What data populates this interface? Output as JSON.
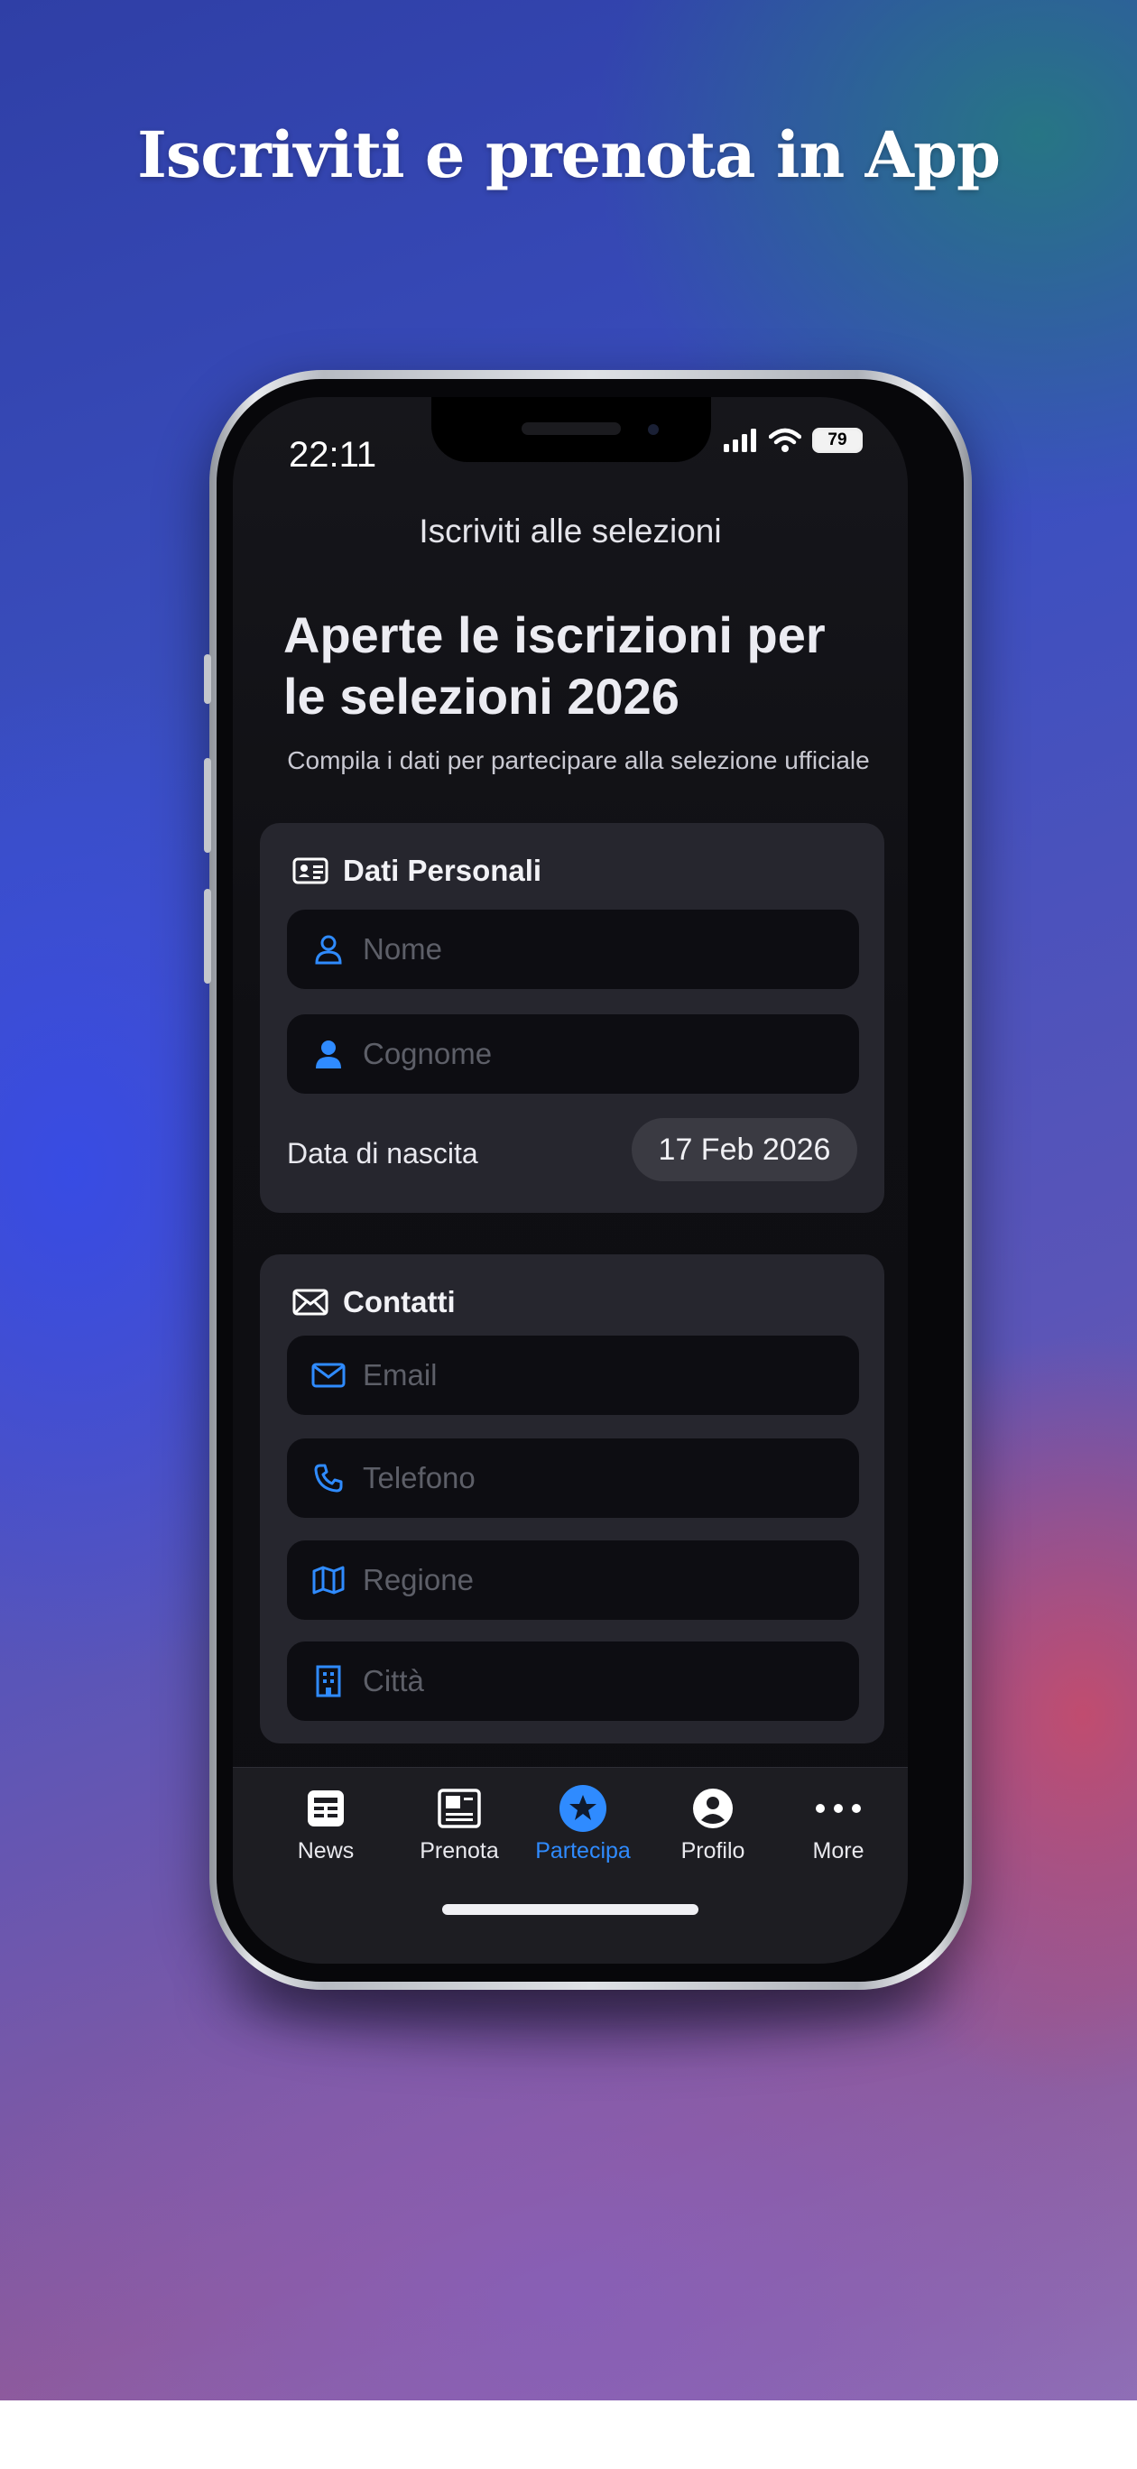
{
  "headline": "Iscriviti e prenota in App",
  "status_bar": {
    "time": "22:11",
    "battery": "79"
  },
  "nav": {
    "title": "Iscriviti alle selezioni"
  },
  "hero": {
    "title": "Aperte le iscrizioni per le selezioni 2026",
    "subtitle": "Compila i dati per partecipare alla selezione ufficiale"
  },
  "personal": {
    "title": "Dati Personali",
    "nome_placeholder": "Nome",
    "cognome_placeholder": "Cognome",
    "birth_label": "Data di nascita",
    "birth_value": "17 Feb 2026"
  },
  "contacts": {
    "title": "Contatti",
    "email_placeholder": "Email",
    "phone_placeholder": "Telefono",
    "region_placeholder": "Regione",
    "city_placeholder": "Città"
  },
  "tabs": [
    {
      "label": "News",
      "icon": "newspaper-icon"
    },
    {
      "label": "Prenota",
      "icon": "booking-icon"
    },
    {
      "label": "Partecipa",
      "icon": "star-circle-icon",
      "active": true
    },
    {
      "label": "Profilo",
      "icon": "person-circle-icon"
    },
    {
      "label": "More",
      "icon": "more-dots-icon"
    }
  ],
  "colors": {
    "accent": "#2f8bff",
    "screen_bg": "#0f0f13",
    "card_bg": "#26262e"
  }
}
